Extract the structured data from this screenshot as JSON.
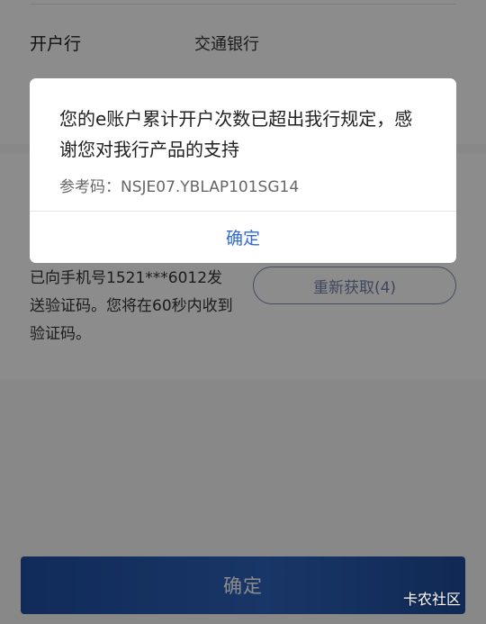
{
  "account_row": {
    "label": "开户行",
    "value": "交通银行"
  },
  "verification": {
    "sms_text": "已向手机号1521***6012发送验证码。您将在60秒内收到验证码。",
    "resend_label": "重新获取(4)"
  },
  "main_button": {
    "label": "确定"
  },
  "dialog": {
    "message": "您的e账户累计开户次数已超出我行规定，感谢您对我行产品的支持",
    "reference": "参考码：NSJE07.YBLAP101SG14",
    "confirm_label": "确定"
  },
  "watermark": "卡农社区",
  "colors": {
    "accent_blue": "#2f6bd0",
    "button_blue": "#2d63bd"
  }
}
